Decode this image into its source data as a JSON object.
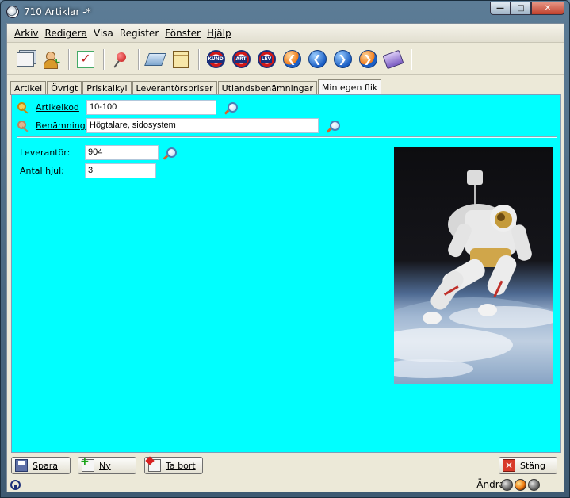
{
  "window": {
    "title": "710 Artiklar -*"
  },
  "menu": [
    "Arkiv",
    "Redigera",
    "Visa",
    "Register",
    "Fönster",
    "Hjälp"
  ],
  "toolbar": {
    "icons": [
      "document-icon",
      "add-user-icon",
      "checklist-icon",
      "pin-icon",
      "book-icon",
      "list-icon",
      "kund-icon",
      "art-icon",
      "lev-icon",
      "first-icon",
      "previous-icon",
      "next-icon",
      "last-icon",
      "notebook-icon"
    ],
    "kund_label": "KUND",
    "art_label": "ART",
    "lev_label": "LEV"
  },
  "tabs": [
    "Artikel",
    "Övrigt",
    "Priskalkyl",
    "Leverantörspriser",
    "Utlandsbenämningar",
    "Min egen flik"
  ],
  "form": {
    "artikelkod_label": "Artikelkod",
    "artikelkod_value": "10-100",
    "benamning_label": "Benämning",
    "benamning_value": "Högtalare, sidosystem",
    "leverantor_label": "Leverantör:",
    "leverantor_value": "904",
    "antal_hjul_label": "Antal hjul:",
    "antal_hjul_value": "3"
  },
  "buttons": {
    "save": "Spara",
    "new": "Ny",
    "delete": "Ta bort",
    "close": "Stäng"
  },
  "status": {
    "mode": "Ändra"
  },
  "colors": {
    "panel": "#00ffff",
    "window_frame": "#4e6d86"
  }
}
